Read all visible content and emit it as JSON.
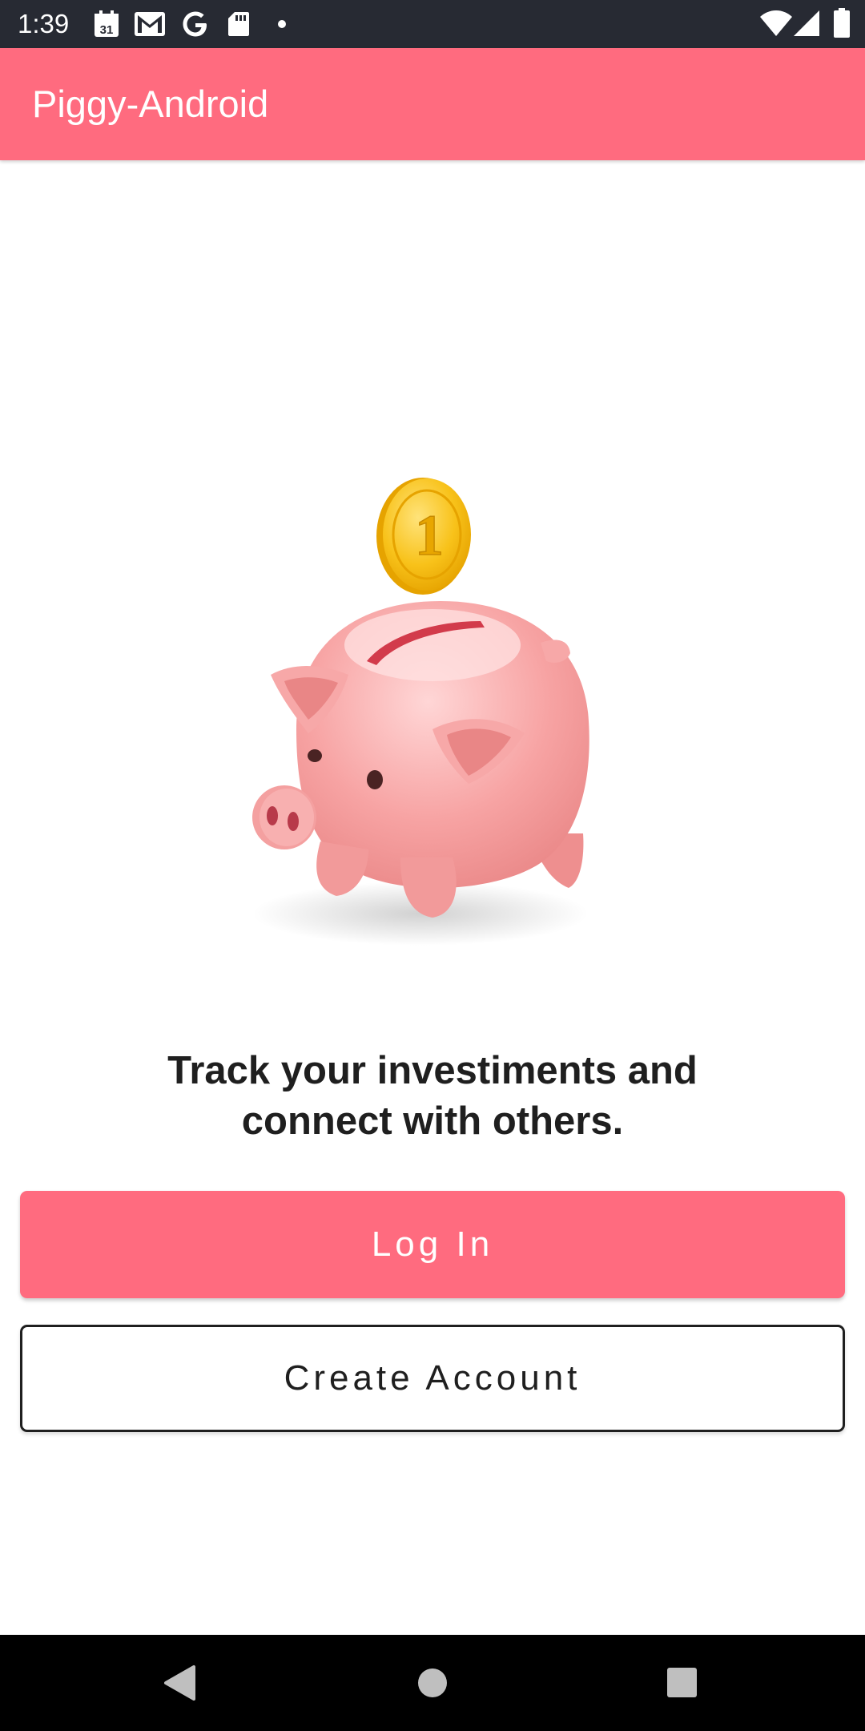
{
  "status_bar": {
    "time": "1:39",
    "icons": [
      "calendar-icon",
      "gmail-icon",
      "google-icon",
      "sd-card-icon",
      "notification-dot-icon",
      "wifi-icon",
      "signal-icon",
      "battery-icon"
    ],
    "calendar_day": "31"
  },
  "app_bar": {
    "title": "Piggy-Android"
  },
  "main": {
    "illustration": "piggy-bank-coin-illustration",
    "coin_digit": "1",
    "tagline_line1": "Track your investiments and",
    "tagline_line2": "connect with others.",
    "login_label": "Log In",
    "create_account_label": "Create Account"
  },
  "nav_bar": {
    "icons": [
      "back-icon",
      "home-icon",
      "recents-icon"
    ]
  },
  "colors": {
    "accent": "#ff6b7f",
    "status_bar": "#272a33",
    "text_dark": "#1f1f1f",
    "nav_bar": "#000000"
  }
}
